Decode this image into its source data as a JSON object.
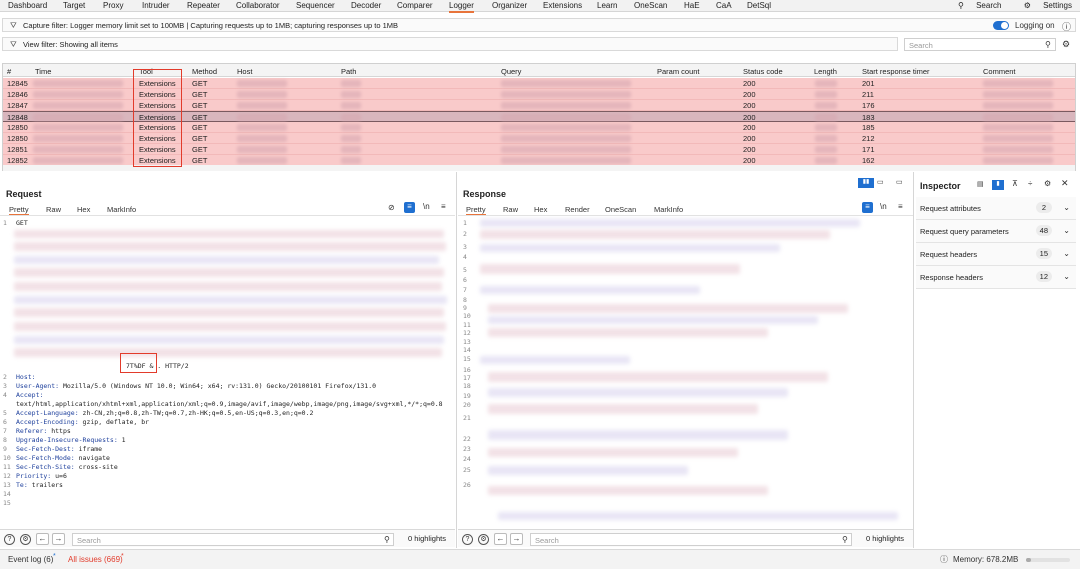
{
  "menu": {
    "tabs": [
      "Dashboard",
      "Target",
      "Proxy",
      "Intruder",
      "Repeater",
      "Collaborator",
      "Sequencer",
      "Decoder",
      "Comparer",
      "Logger",
      "Organizer",
      "Extensions",
      "Learn",
      "OneScan",
      "HaE",
      "CaA",
      "DetSql"
    ],
    "active_tab": "Logger",
    "search_label": "Search",
    "settings_label": "Settings"
  },
  "capture_filter": {
    "text": "Capture filter: Logger memory limit set to 100MB | Capturing requests up to 1MB;  capturing responses up to 1MB",
    "logging_label": "Logging on",
    "logging_on": true
  },
  "view_filter": {
    "text": "View filter: Showing all items",
    "search_placeholder": "Search"
  },
  "table": {
    "columns": [
      "#",
      "Time",
      "Tool",
      "Method",
      "Host",
      "Path",
      "Query",
      "Param count",
      "Status code",
      "Length",
      "Start response timer",
      "Comment"
    ],
    "rows": [
      {
        "num": "12845",
        "tool": "Extensions",
        "method": "GET",
        "status": "200",
        "timer": "201"
      },
      {
        "num": "12846",
        "tool": "Extensions",
        "method": "GET",
        "status": "200",
        "timer": "211"
      },
      {
        "num": "12847",
        "tool": "Extensions",
        "method": "GET",
        "status": "200",
        "timer": "176"
      },
      {
        "num": "12848",
        "tool": "Extensions",
        "method": "GET",
        "status": "200",
        "timer": "183"
      },
      {
        "num": "12850",
        "tool": "Extensions",
        "method": "GET",
        "status": "200",
        "timer": "185"
      },
      {
        "num": "12850",
        "tool": "Extensions",
        "method": "GET",
        "status": "200",
        "timer": "212"
      },
      {
        "num": "12851",
        "tool": "Extensions",
        "method": "GET",
        "status": "200",
        "timer": "171"
      },
      {
        "num": "12852",
        "tool": "Extensions",
        "method": "GET",
        "status": "200",
        "timer": "162"
      }
    ],
    "selected_index": 3
  },
  "request": {
    "title": "Request",
    "tabs": [
      "Pretty",
      "Raw",
      "Hex",
      "MarkInfo"
    ],
    "active_tab": "Pretty",
    "line1_method": "GET",
    "request_line_tail": "7T%DF & . HTTP/2",
    "headers": [
      {
        "n": "2",
        "key": "Host:",
        "val": ""
      },
      {
        "n": "3",
        "key": "User-Agent:",
        "val": " Mozilla/5.0 (Windows NT 10.0; Win64; x64; rv:131.0) Gecko/20100101 Firefox/131.0"
      },
      {
        "n": "4",
        "key": "Accept:",
        "val": ""
      },
      {
        "n": "",
        "key": "",
        "val": "text/html,application/xhtml+xml,application/xml;q=0.9,image/avif,image/webp,image/png,image/svg+xml,*/*;q=0.8"
      },
      {
        "n": "5",
        "key": "Accept-Language:",
        "val": " zh-CN,zh;q=0.8,zh-TW;q=0.7,zh-HK;q=0.5,en-US;q=0.3,en;q=0.2"
      },
      {
        "n": "6",
        "key": "Accept-Encoding:",
        "val": " gzip, deflate, br"
      },
      {
        "n": "7",
        "key": "Referer:",
        "val": " https"
      },
      {
        "n": "8",
        "key": "Upgrade-Insecure-Requests:",
        "val": " 1"
      },
      {
        "n": "9",
        "key": "Sec-Fetch-Dest:",
        "val": " iframe"
      },
      {
        "n": "10",
        "key": "Sec-Fetch-Mode:",
        "val": " navigate"
      },
      {
        "n": "11",
        "key": "Sec-Fetch-Site:",
        "val": " cross-site"
      },
      {
        "n": "12",
        "key": "Priority:",
        "val": " u=6"
      },
      {
        "n": "13",
        "key": "Te:",
        "val": " trailers"
      },
      {
        "n": "14",
        "key": "",
        "val": ""
      },
      {
        "n": "15",
        "key": "",
        "val": ""
      }
    ],
    "search_placeholder": "Search",
    "highlights": "0 highlights"
  },
  "response": {
    "title": "Response",
    "tabs": [
      "Pretty",
      "Raw",
      "Hex",
      "Render",
      "OneScan",
      "MarkInfo"
    ],
    "active_tab": "Pretty",
    "line_numbers": [
      "1",
      "2",
      "3",
      "4",
      "5",
      "6",
      "7",
      "8",
      "9",
      "10",
      "11",
      "12",
      "13",
      "14",
      "15",
      "16",
      "17",
      "18",
      "19",
      "20",
      "21",
      "22",
      "23",
      "24",
      "25",
      "26"
    ],
    "search_placeholder": "Search",
    "highlights": "0 highlights"
  },
  "inspector": {
    "title": "Inspector",
    "rows": [
      {
        "label": "Request attributes",
        "count": "2"
      },
      {
        "label": "Request query parameters",
        "count": "48"
      },
      {
        "label": "Request headers",
        "count": "15"
      },
      {
        "label": "Response headers",
        "count": "12"
      }
    ]
  },
  "status": {
    "event_log": "Event log (6)",
    "all_issues": "All issues (669)",
    "memory": "Memory: 678.2MB"
  },
  "colors": {
    "row_pink": "#f9caca",
    "row_selected": "#d9b6bd",
    "accent_orange": "#e8743b",
    "annotation_red": "#e23b2b",
    "toggle_blue": "#1f6fd0"
  }
}
